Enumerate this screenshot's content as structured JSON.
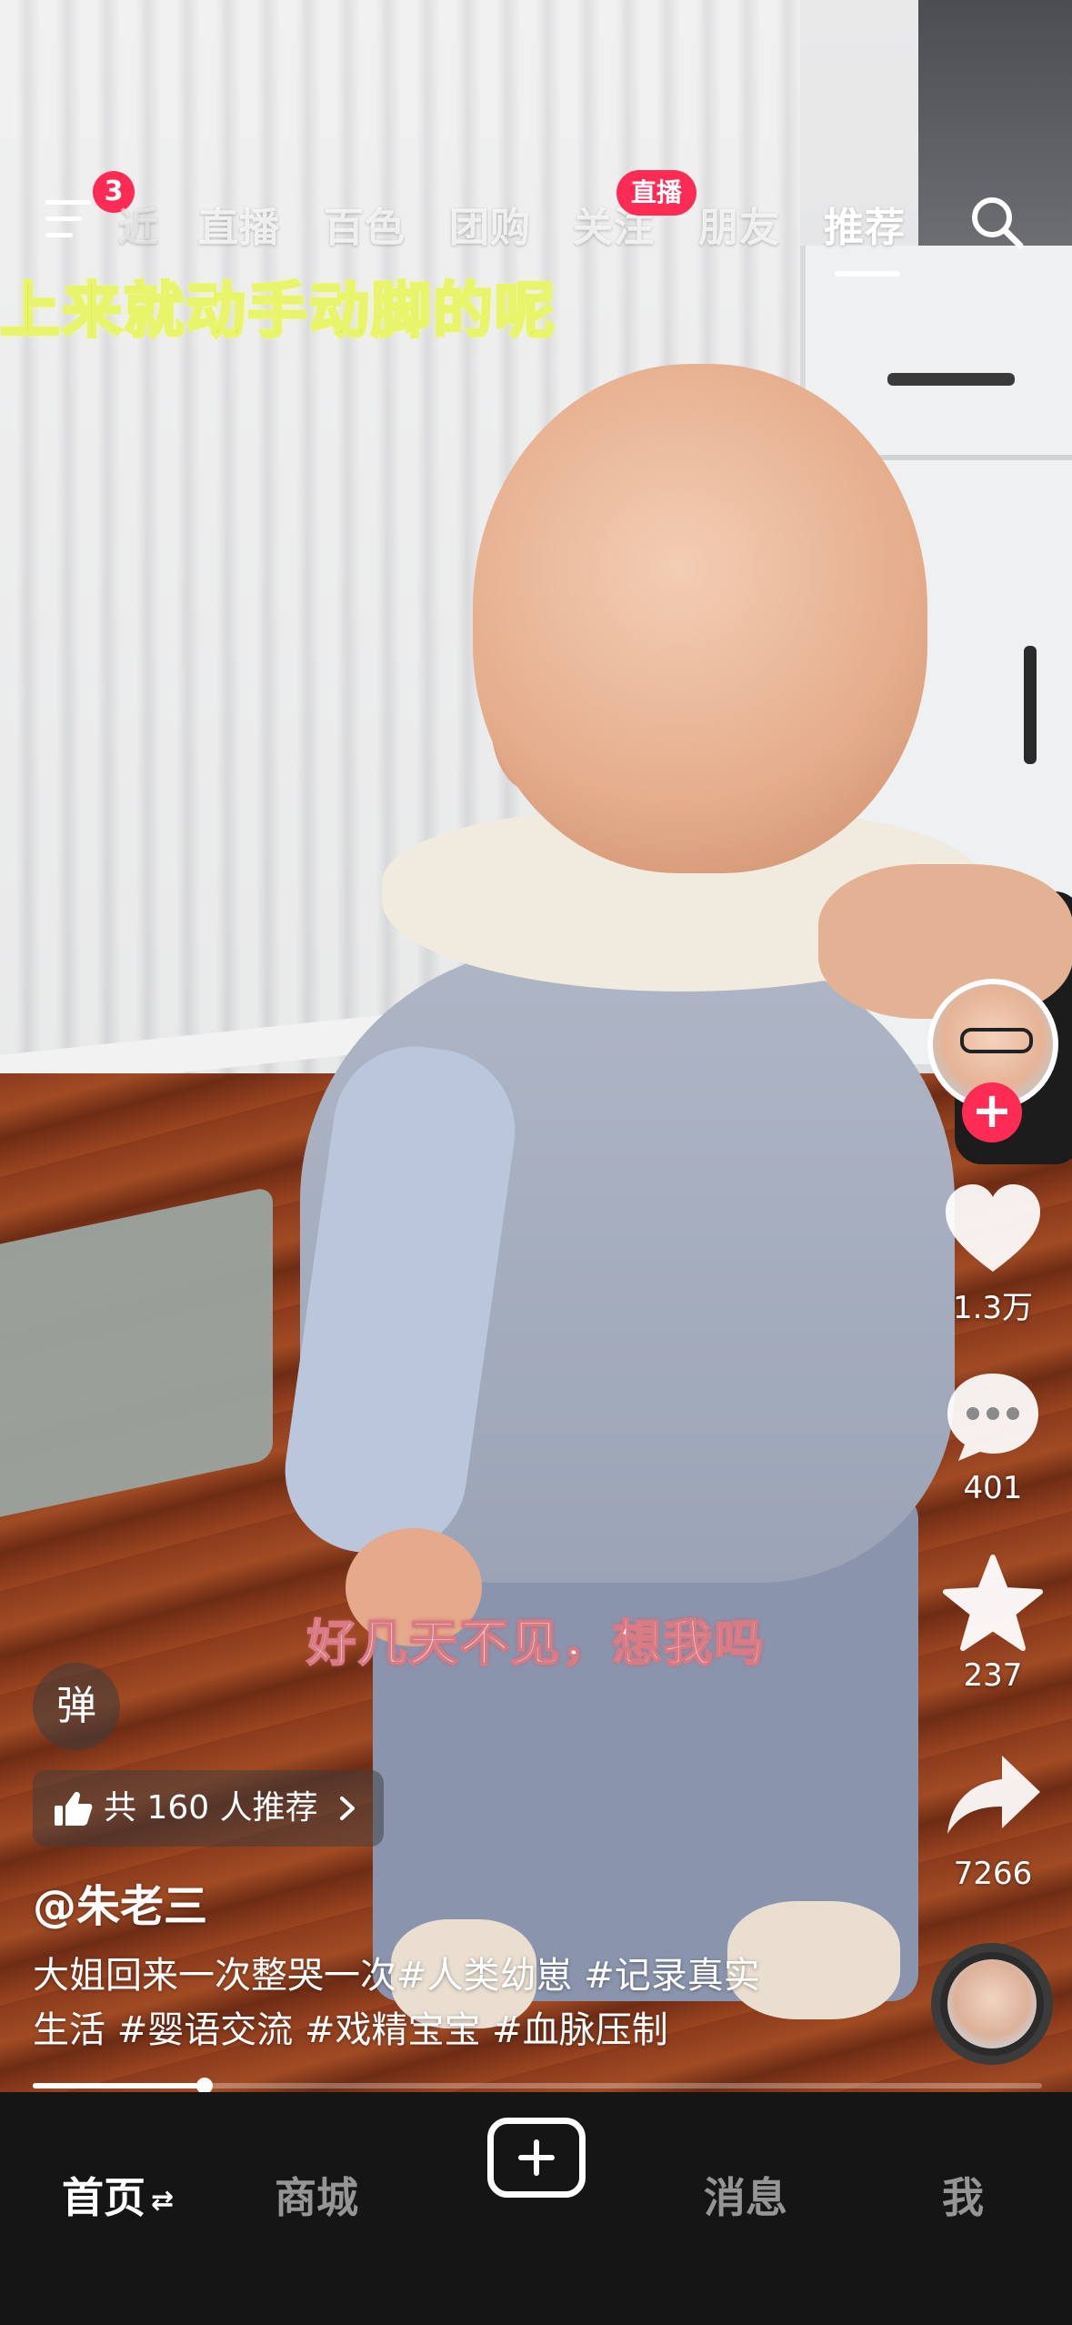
{
  "top_nav": {
    "menu_badge": "3",
    "tabs": [
      "直播",
      "百色",
      "团购",
      "关注",
      "朋友",
      "推荐"
    ],
    "hidden_tab_fragment": "近",
    "active_tab": "推荐",
    "live_badge": "直播"
  },
  "video_overlay": {
    "top_caption": "上来就动手动脚的呢",
    "subtitle": "好几天不见，想我吗"
  },
  "side_actions": {
    "likes": "1.3万",
    "comments": "401",
    "favorites": "237",
    "shares": "7266"
  },
  "info": {
    "danmu_label": "弹",
    "recommend_text": "共 160 人推荐",
    "author": "@朱老三",
    "description_line1": "大姐回来一次整哭一次#人类幼崽 #记录真实",
    "description_line2": "生活 #婴语交流 #戏精宝宝 #血脉压制"
  },
  "progress": {
    "fraction": 0.17
  },
  "bottom_nav": {
    "home": "首页",
    "mall": "商城",
    "messages": "消息",
    "me": "我"
  },
  "colors": {
    "accent": "#fe2c55",
    "nav_background": "#151515"
  },
  "icons": [
    "menu-icon",
    "search-icon",
    "follow-plus-icon",
    "heart-icon",
    "comment-icon",
    "star-icon",
    "share-icon",
    "thumbs-up-icon",
    "chevron-right-icon",
    "create-plus-icon",
    "switch-arrows-icon"
  ]
}
